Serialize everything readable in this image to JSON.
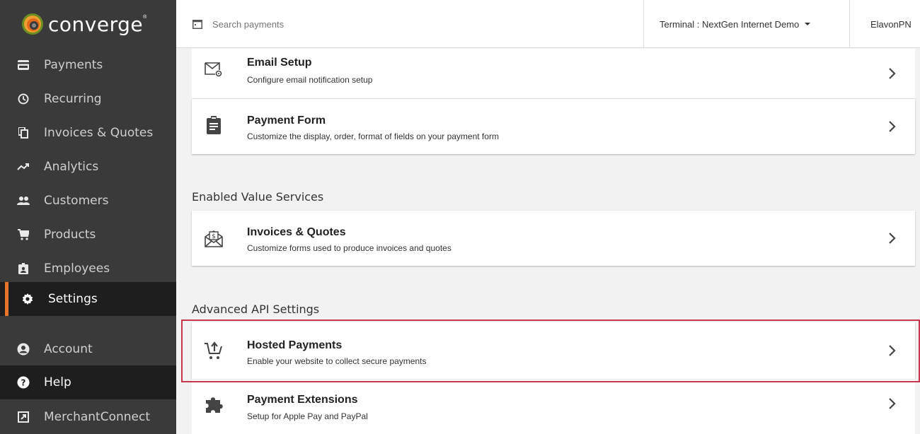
{
  "brand": {
    "name": "converge",
    "reg": "®"
  },
  "sidebar": {
    "items": [
      {
        "label": "Payments",
        "icon": "credit-card-icon"
      },
      {
        "label": "Recurring",
        "icon": "clock-icon"
      },
      {
        "label": "Invoices & Quotes",
        "icon": "copy-icon"
      },
      {
        "label": "Analytics",
        "icon": "trend-icon"
      },
      {
        "label": "Customers",
        "icon": "people-icon"
      },
      {
        "label": "Products",
        "icon": "cart-icon"
      },
      {
        "label": "Employees",
        "icon": "badge-icon"
      },
      {
        "label": "Settings",
        "icon": "gear-icon",
        "active": true
      },
      {
        "label": "Account",
        "icon": "account-icon"
      },
      {
        "label": "Help",
        "icon": "help-icon"
      },
      {
        "label": "MerchantConnect",
        "icon": "external-link-icon"
      }
    ]
  },
  "header": {
    "search_placeholder": "Search payments",
    "terminal_label": "Terminal : NextGen Internet Demo",
    "user": "ElavonPN"
  },
  "cards": {
    "email_setup": {
      "title": "Email Setup",
      "desc": "Configure email notification setup"
    },
    "payment_form": {
      "title": "Payment Form",
      "desc": "Customize the display, order, format of fields on your payment form"
    },
    "invoices_quotes": {
      "title": "Invoices & Quotes",
      "desc": "Customize forms used to produce invoices and quotes"
    },
    "hosted_payments": {
      "title": "Hosted Payments",
      "desc": "Enable your website to collect secure payments"
    },
    "payment_extensions": {
      "title": "Payment Extensions",
      "desc": "Setup for Apple Pay and PayPal"
    }
  },
  "sections": {
    "enabled_value_services": "Enabled Value Services",
    "advanced_api_settings": "Advanced API Settings"
  },
  "colors": {
    "sidebar_bg": "#3a3a3a",
    "sidebar_active_bg": "#1e1e1e",
    "accent_orange": "#e8732a",
    "highlight_red": "#c8354d"
  }
}
